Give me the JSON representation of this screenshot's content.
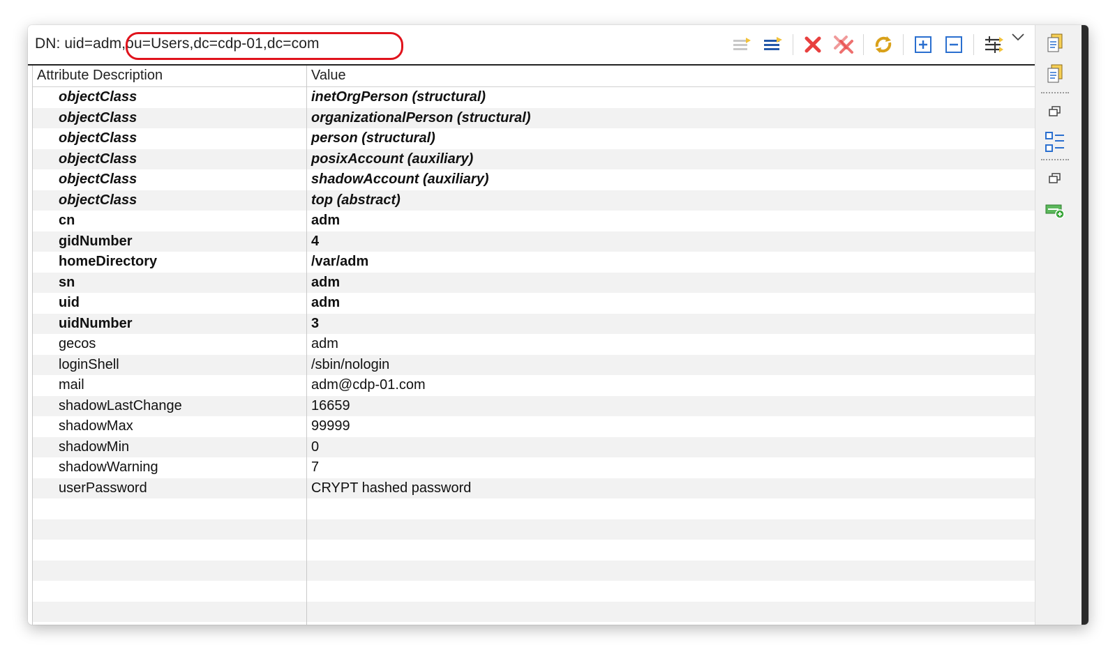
{
  "dn": {
    "label": "DN: uid=adm",
    "rest": ",ou=Users,dc=cdp-01,dc=com"
  },
  "toolbar": {
    "buttons": [
      {
        "name": "new-value-icon"
      },
      {
        "name": "new-attribute-icon"
      },
      {
        "name": "delete-icon"
      },
      {
        "name": "delete-all-icon"
      },
      {
        "name": "refresh-icon"
      },
      {
        "name": "expand-all-icon"
      },
      {
        "name": "collapse-all-icon"
      },
      {
        "name": "filter-icon"
      },
      {
        "name": "view-menu-icon"
      }
    ]
  },
  "table": {
    "columns": [
      "Attribute Description",
      "Value"
    ],
    "rows": [
      {
        "attr": "objectClass",
        "value": "inetOrgPerson (structural)",
        "kind": "oc"
      },
      {
        "attr": "objectClass",
        "value": "organizationalPerson (structural)",
        "kind": "oc"
      },
      {
        "attr": "objectClass",
        "value": "person (structural)",
        "kind": "oc"
      },
      {
        "attr": "objectClass",
        "value": "posixAccount (auxiliary)",
        "kind": "oc"
      },
      {
        "attr": "objectClass",
        "value": "shadowAccount (auxiliary)",
        "kind": "oc"
      },
      {
        "attr": "objectClass",
        "value": "top (abstract)",
        "kind": "oc"
      },
      {
        "attr": "cn",
        "value": "adm",
        "kind": "must"
      },
      {
        "attr": "gidNumber",
        "value": "4",
        "kind": "must"
      },
      {
        "attr": "homeDirectory",
        "value": "/var/adm",
        "kind": "must"
      },
      {
        "attr": "sn",
        "value": "adm",
        "kind": "must"
      },
      {
        "attr": "uid",
        "value": "adm",
        "kind": "must"
      },
      {
        "attr": "uidNumber",
        "value": "3",
        "kind": "must"
      },
      {
        "attr": "gecos",
        "value": "adm",
        "kind": "may"
      },
      {
        "attr": "loginShell",
        "value": "/sbin/nologin",
        "kind": "may"
      },
      {
        "attr": "mail",
        "value": "adm@cdp-01.com",
        "kind": "may"
      },
      {
        "attr": "shadowLastChange",
        "value": "16659",
        "kind": "may"
      },
      {
        "attr": "shadowMax",
        "value": "99999",
        "kind": "may"
      },
      {
        "attr": "shadowMin",
        "value": "0",
        "kind": "may"
      },
      {
        "attr": "shadowWarning",
        "value": "7",
        "kind": "may"
      },
      {
        "attr": "userPassword",
        "value": "CRYPT hashed password",
        "kind": "may"
      },
      {
        "attr": "",
        "value": "",
        "kind": "empty"
      },
      {
        "attr": "",
        "value": "",
        "kind": "empty"
      },
      {
        "attr": "",
        "value": "",
        "kind": "empty"
      },
      {
        "attr": "",
        "value": "",
        "kind": "empty"
      },
      {
        "attr": "",
        "value": "",
        "kind": "empty"
      },
      {
        "attr": "",
        "value": "",
        "kind": "empty"
      }
    ]
  },
  "sidebar": {
    "buttons": [
      {
        "name": "properties-icon"
      },
      {
        "name": "properties-alt-icon"
      },
      {
        "name": "restore-icon"
      },
      {
        "name": "outline-icon"
      },
      {
        "name": "restore-icon-2"
      },
      {
        "name": "add-entry-icon"
      }
    ]
  },
  "colors": {
    "highlight": "#e0131c",
    "delete": "#e8403f",
    "accent": "#2a6fcf"
  }
}
